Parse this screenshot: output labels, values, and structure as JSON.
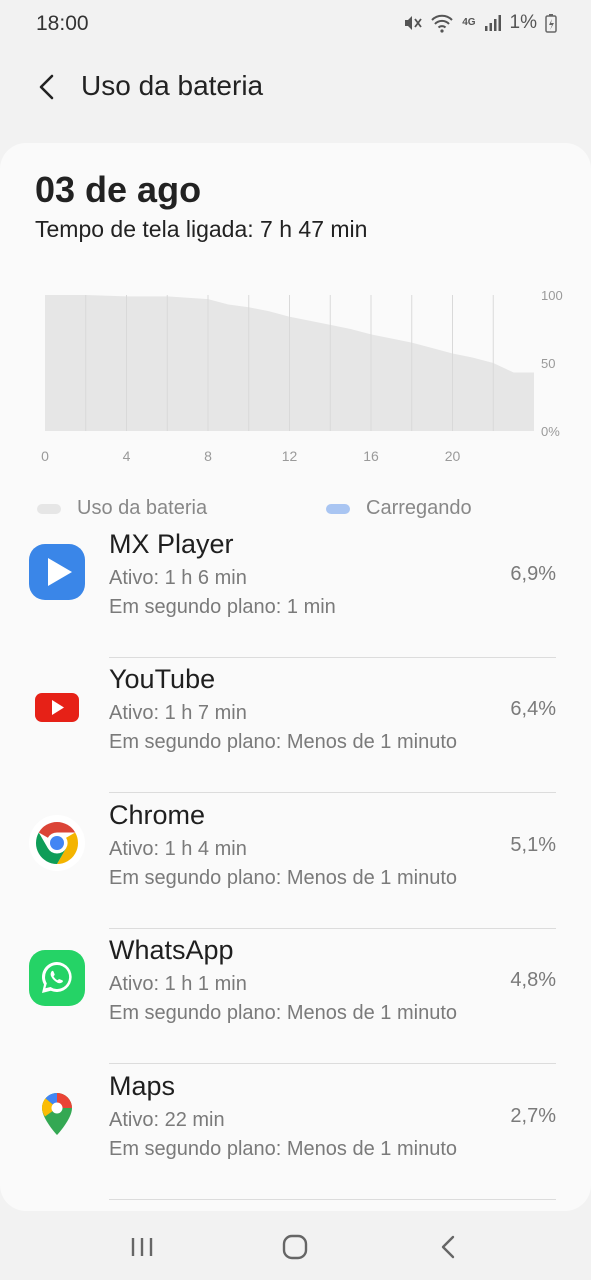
{
  "status": {
    "time": "18:00",
    "battery": "1%",
    "network": "4G"
  },
  "header": {
    "title": "Uso da bateria"
  },
  "summary": {
    "date": "03 de ago",
    "screen_time": "Tempo de tela ligada: 7 h 47 min"
  },
  "chart_data": {
    "type": "area",
    "x_ticks": [
      "0",
      "4",
      "8",
      "12",
      "16",
      "20"
    ],
    "y_ticks": [
      "100",
      "50",
      "0%"
    ],
    "xlim": [
      0,
      24
    ],
    "ylim": [
      0,
      100
    ],
    "series": [
      {
        "name": "Uso da bateria",
        "x": [
          0,
          2,
          4,
          6,
          7,
          8,
          9,
          10,
          11,
          12,
          13,
          14,
          15,
          16,
          17,
          18,
          19,
          20,
          21,
          22,
          23,
          24
        ],
        "values": [
          100,
          100,
          99,
          99,
          98,
          97,
          93,
          91,
          88,
          84,
          81,
          78,
          75,
          71,
          68,
          65,
          61,
          57,
          54,
          50,
          43,
          43
        ]
      }
    ],
    "legend": [
      {
        "label": "Uso da bateria",
        "color": "#e6e6e6"
      },
      {
        "label": "Carregando",
        "color": "#a9c5f2"
      }
    ]
  },
  "apps": [
    {
      "name": "MX Player",
      "active": "Ativo: 1 h 6 min",
      "background": "Em segundo plano: 1 min",
      "percent": "6,9%",
      "icon": "mx-player-icon"
    },
    {
      "name": "YouTube",
      "active": "Ativo: 1 h 7 min",
      "background": "Em segundo plano: Menos de 1 minuto",
      "percent": "6,4%",
      "icon": "youtube-icon"
    },
    {
      "name": "Chrome",
      "active": "Ativo: 1 h 4 min",
      "background": "Em segundo plano: Menos de 1 minuto",
      "percent": "5,1%",
      "icon": "chrome-icon"
    },
    {
      "name": "WhatsApp",
      "active": "Ativo: 1 h 1 min",
      "background": "Em segundo plano: Menos de 1 minuto",
      "percent": "4,8%",
      "icon": "whatsapp-icon"
    },
    {
      "name": "Maps",
      "active": "Ativo: 22 min",
      "background": "Em segundo plano: Menos de 1 minuto",
      "percent": "2,7%",
      "icon": "maps-icon"
    }
  ],
  "nav": {
    "recents": "recents-icon",
    "home": "home-icon",
    "back": "back-icon"
  }
}
